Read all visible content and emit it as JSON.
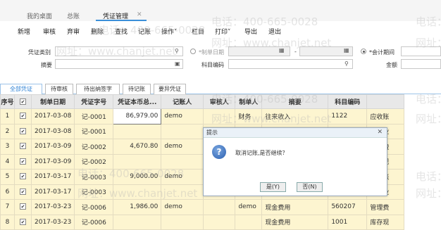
{
  "tabs": [
    {
      "label": "我的桌面"
    },
    {
      "label": "总账"
    },
    {
      "label": "凭证管理"
    }
  ],
  "toolbar": [
    "新增",
    "审核",
    "弃审",
    "删除",
    "查找",
    "记账",
    "操作",
    "栏目",
    "打印",
    "导出",
    "退出"
  ],
  "toolbar_dropdowns": {
    "op": "操作",
    "print": "打印"
  },
  "filter": {
    "voucher_type_label": "凭证类别",
    "summary_label": "摘要",
    "maker_date_label": "*制单日期",
    "date_sep": "-",
    "account_code_label": "科目编码",
    "period_label": "*会计期间",
    "amount_label": "金额"
  },
  "subtabs": [
    "全部凭证",
    "待审核",
    "待出纳签字",
    "待记账",
    "要异凭证"
  ],
  "table": {
    "headers": [
      "序号",
      "",
      "制单日期",
      "凭证字号",
      "凭证本币总...",
      "记账人",
      "审核人",
      "制单人",
      "摘要",
      "科目编码",
      ""
    ],
    "rows": [
      {
        "no": "1",
        "date": "2017-03-08",
        "voucher": "记-0001",
        "amount": "86,979.00",
        "poster": "demo",
        "auditor": "",
        "maker": "财务",
        "summary": "往来收入",
        "code": "1122",
        "name": "应收账"
      },
      {
        "no": "2",
        "date": "2017-03-08",
        "voucher": "记-0001",
        "amount": "",
        "poster": "",
        "auditor": "",
        "maker": "",
        "summary": "",
        "code": "",
        "name": "其他业"
      },
      {
        "no": "3",
        "date": "2017-03-09",
        "voucher": "记-0002",
        "amount": "4,670.80",
        "poster": "demo",
        "auditor": "",
        "maker": "",
        "summary": "",
        "code": "",
        "name": "管理费"
      },
      {
        "no": "4",
        "date": "2017-03-09",
        "voucher": "记-0002",
        "amount": "",
        "poster": "",
        "auditor": "",
        "maker": "",
        "summary": "",
        "code": "",
        "name": "库存现"
      },
      {
        "no": "5",
        "date": "2017-03-17",
        "voucher": "记-0003",
        "amount": "9,000.00",
        "poster": "demo",
        "auditor": "",
        "maker": "",
        "summary": "",
        "code": "",
        "name": "应收账"
      },
      {
        "no": "6",
        "date": "2017-03-17",
        "voucher": "记-0003",
        "amount": "",
        "poster": "",
        "auditor": "",
        "maker": "",
        "summary": "",
        "code": "",
        "name": "其他业"
      },
      {
        "no": "7",
        "date": "2017-03-23",
        "voucher": "记-0006",
        "amount": "1,986.00",
        "poster": "demo",
        "auditor": "",
        "maker": "demo",
        "summary": "现金费用",
        "code": "560207",
        "name": "管理费"
      },
      {
        "no": "8",
        "date": "2017-03-23",
        "voucher": "记-0006",
        "amount": "",
        "poster": "",
        "auditor": "",
        "maker": "",
        "summary": "现金费用",
        "code": "1001",
        "name": "库存现"
      }
    ]
  },
  "dialog": {
    "title": "提示",
    "message": "取消记账,是否继续？",
    "yes": "是(Y)",
    "no": "否(N)"
  },
  "watermark": {
    "phone": "电话：400-665-0028",
    "site": "网址：www.chanjet.net",
    "site_short": "网址："
  }
}
